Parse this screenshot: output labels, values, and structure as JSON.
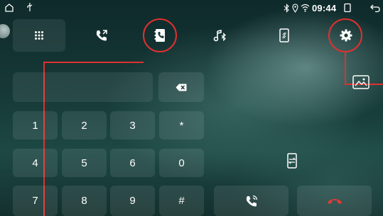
{
  "status_bar": {
    "time": "09:44",
    "icons": [
      "home-icon",
      "usb-icon",
      "bluetooth-icon",
      "location-icon",
      "wifi-icon",
      "recent-apps-icon",
      "back-icon"
    ]
  },
  "tabs": [
    {
      "id": "dialpad",
      "icon": "dialpad-icon",
      "active": true
    },
    {
      "id": "call-log",
      "icon": "call-log-icon",
      "active": false
    },
    {
      "id": "contacts",
      "icon": "contacts-icon",
      "active": false,
      "highlighted": true
    },
    {
      "id": "bt-music",
      "icon": "bluetooth-music-icon",
      "active": false
    },
    {
      "id": "phone-link",
      "icon": "phone-link-icon",
      "active": false
    },
    {
      "id": "settings",
      "icon": "settings-icon",
      "active": false,
      "highlighted": true
    }
  ],
  "keypad": {
    "keys": [
      "1",
      "2",
      "3",
      "*",
      "4",
      "5",
      "6",
      "0",
      "7",
      "8",
      "9",
      "#"
    ],
    "number_field": "",
    "delete_icon": "backspace-icon"
  },
  "actions": {
    "transfer_icon": "audio-transfer-icon",
    "call_icon": "call-icon",
    "hangup_icon": "hangup-icon",
    "gallery_icon": "gallery-icon"
  },
  "colors": {
    "annotation": "#e03030",
    "hangup": "#e53935"
  }
}
